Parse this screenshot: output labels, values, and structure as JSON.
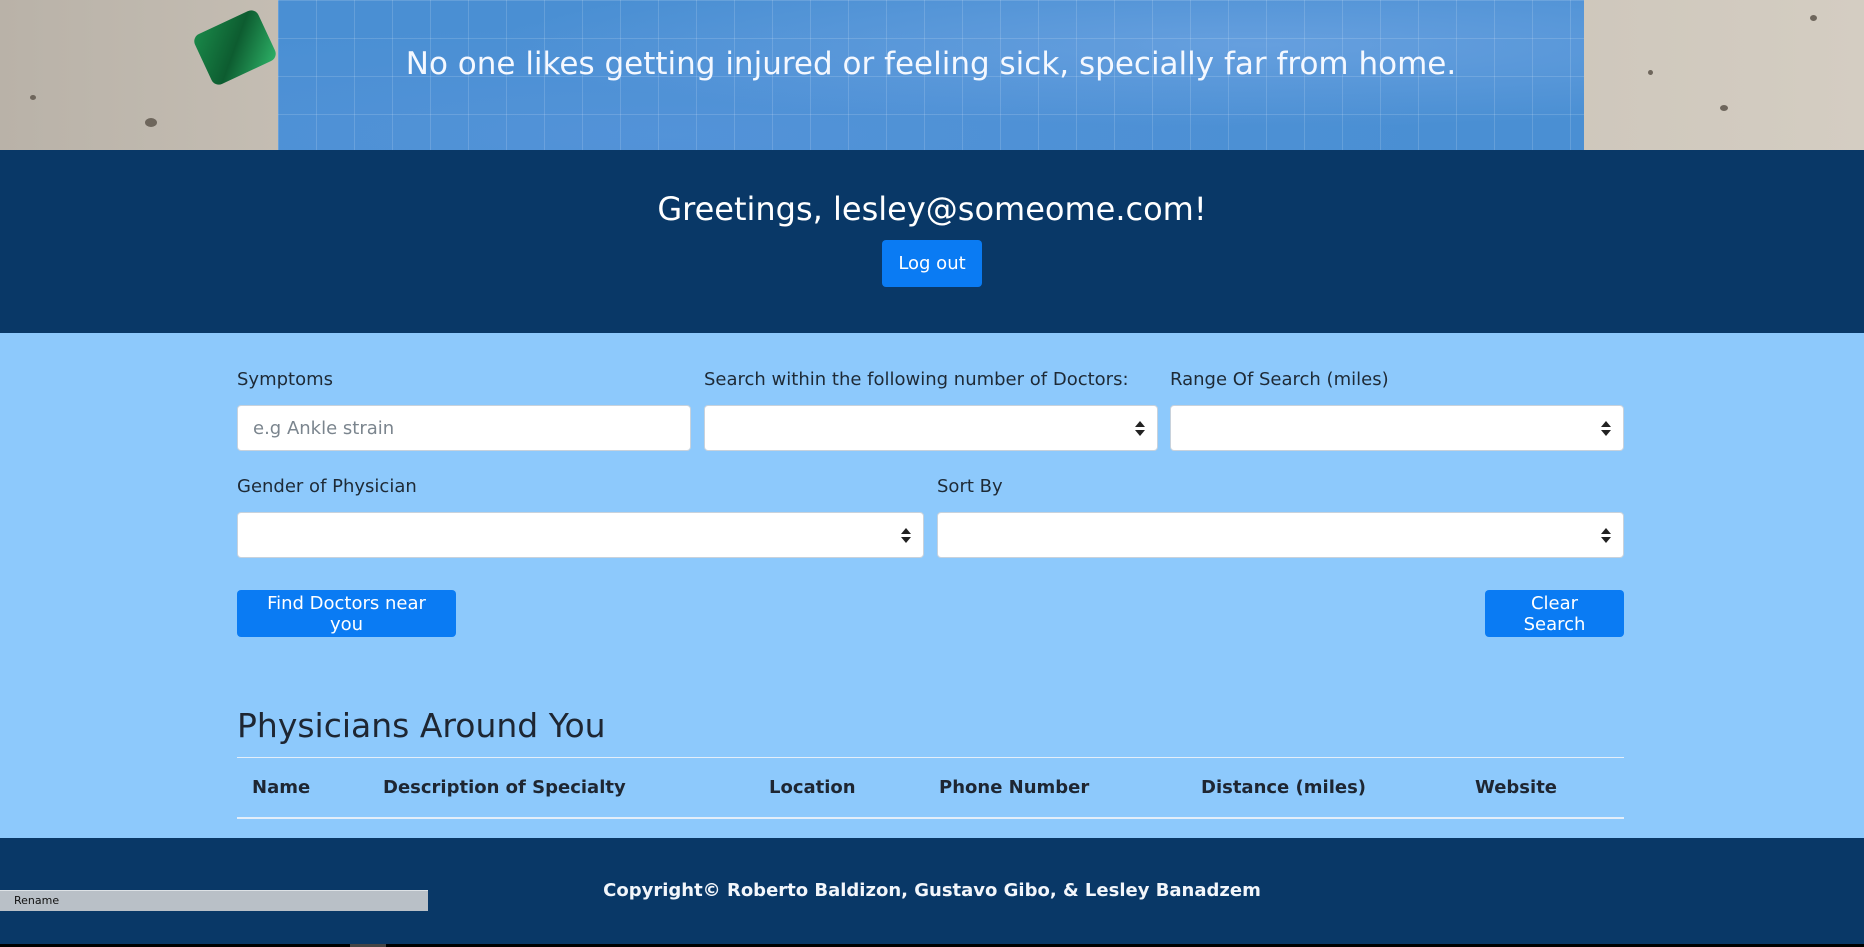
{
  "hero": {
    "tagline": "No one likes getting injured or feeling sick, specially far from home."
  },
  "greeting": {
    "text": "Greetings, lesley@someome.com!",
    "logout_label": "Log out"
  },
  "search": {
    "symptoms_label": "Symptoms",
    "symptoms_placeholder": "e.g Ankle strain",
    "symptoms_value": "",
    "doctors_count_label": "Search within the following number of Doctors:",
    "doctors_count_value": "",
    "range_label": "Range Of Search (miles)",
    "range_value": "",
    "gender_label": "Gender of Physician",
    "gender_value": "",
    "sort_label": "Sort By",
    "sort_value": "",
    "find_label": "Find Doctors near you",
    "clear_label": "Clear Search"
  },
  "results": {
    "title": "Physicians Around You",
    "columns": [
      "Name",
      "Description of Specialty",
      "Location",
      "Phone Number",
      "Distance (miles)",
      "Website"
    ]
  },
  "footer": {
    "copyright": "Copyright© Roberto Baldizon, Gustavo Gibo, & Lesley Banadzem"
  },
  "taskbar": {
    "tooltip": "Rename"
  },
  "colors": {
    "primary_button": "#0a7bf3",
    "dark_band": "#093867",
    "light_section": "#8dc9fc"
  }
}
